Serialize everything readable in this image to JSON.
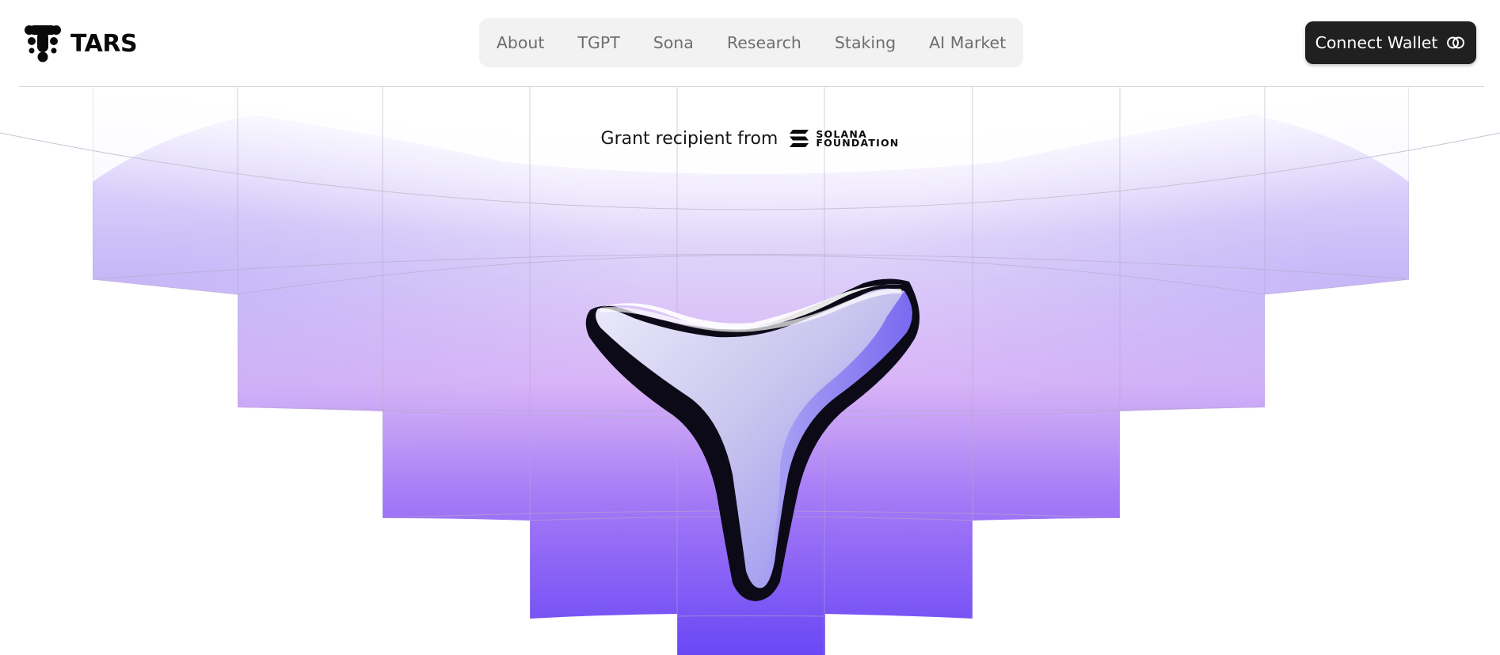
{
  "brand": {
    "name": "TARS",
    "logo_icon": "tars-logo-icon"
  },
  "nav": {
    "items": [
      {
        "label": "About"
      },
      {
        "label": "TGPT"
      },
      {
        "label": "Sona"
      },
      {
        "label": "Research"
      },
      {
        "label": "Staking"
      },
      {
        "label": "AI Market"
      }
    ]
  },
  "header": {
    "connect_label": "Connect Wallet",
    "connect_icon": "link-icon"
  },
  "hero": {
    "grant_text": "Grant recipient from",
    "solana_line1": "SOLANA",
    "solana_line2": "FOUNDATION",
    "solana_icon": "solana-logo-icon",
    "centerpiece": "tars-3d-logo"
  },
  "colors": {
    "lavender": "#d9d3fb",
    "pink": "#dca9f7",
    "violet": "#7554f5",
    "button_bg": "#202020",
    "nav_bg": "#f2f2f2"
  }
}
